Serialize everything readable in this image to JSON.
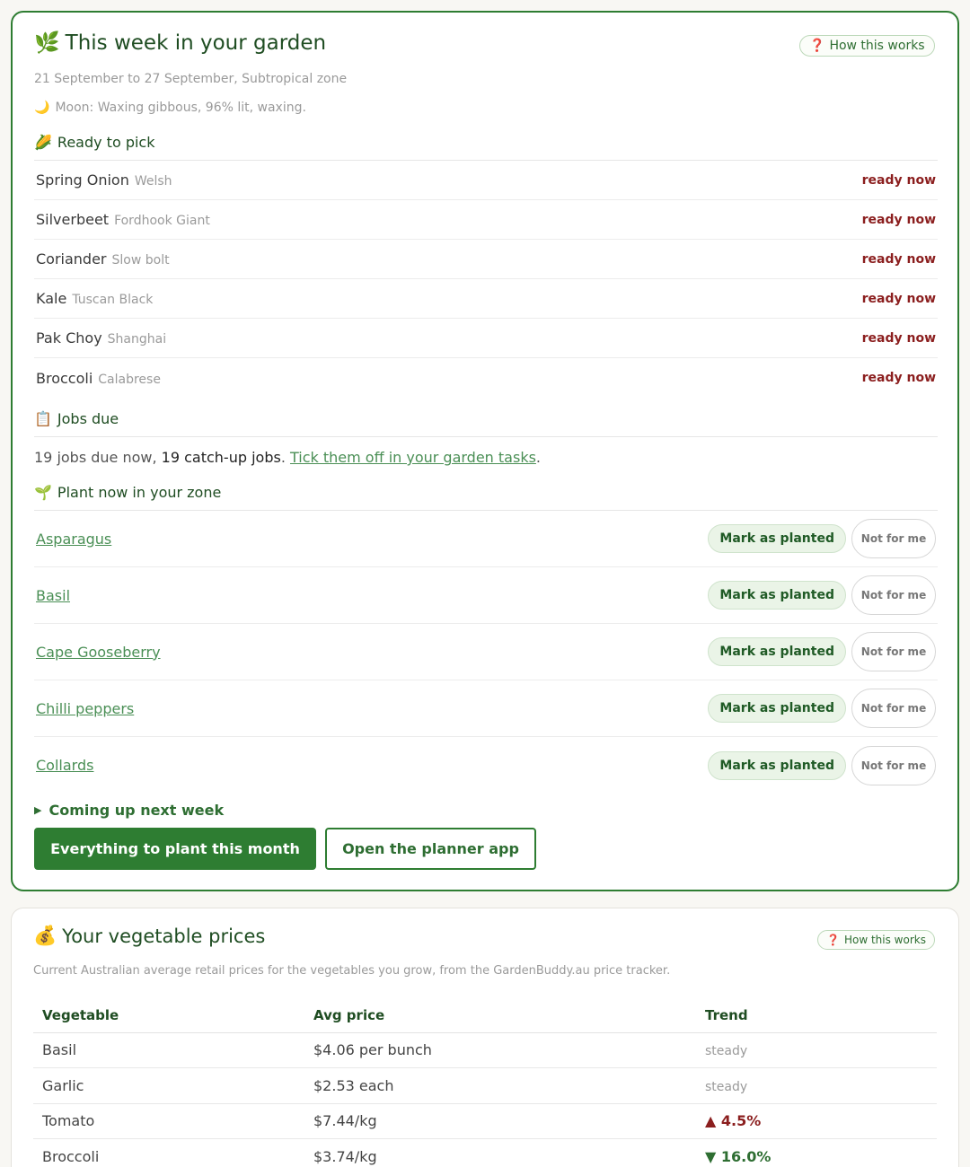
{
  "garden": {
    "emoji": "🌿",
    "title": "This week in your garden",
    "help_label": "How this works",
    "help_icon": "❓",
    "date_range": "21 September to 27 September, Subtropical zone",
    "moon_emoji": "🌙",
    "moon": "Moon: Waxing gibbous, 96% lit, waxing.",
    "ready": {
      "emoji": "🌽",
      "heading": "Ready to pick",
      "items": [
        {
          "name": "Spring Onion",
          "variety": "Welsh",
          "status": "ready now"
        },
        {
          "name": "Silverbeet",
          "variety": "Fordhook Giant",
          "status": "ready now"
        },
        {
          "name": "Coriander",
          "variety": "Slow bolt",
          "status": "ready now"
        },
        {
          "name": "Kale",
          "variety": "Tuscan Black",
          "status": "ready now"
        },
        {
          "name": "Pak Choy",
          "variety": "Shanghai",
          "status": "ready now"
        },
        {
          "name": "Broccoli",
          "variety": "Calabrese",
          "status": "ready now"
        }
      ]
    },
    "jobs": {
      "emoji": "📋",
      "heading": "Jobs due",
      "due_text": "19 jobs due now, ",
      "catchup_text": "19 catch-up jobs",
      "sep": ". ",
      "link_text": "Tick them off in your garden tasks",
      "end": "."
    },
    "plant_now": {
      "emoji": "🌱",
      "heading": "Plant now in your zone",
      "mark_label": "Mark as planted",
      "not_label": "Not for me",
      "items": [
        {
          "name": "Asparagus"
        },
        {
          "name": "Basil"
        },
        {
          "name": "Cape Gooseberry"
        },
        {
          "name": "Chilli peppers"
        },
        {
          "name": "Collards"
        }
      ]
    },
    "coming_up": "Coming up next week",
    "btn_month": "Everything to plant this month",
    "btn_planner": "Open the planner app"
  },
  "prices": {
    "emoji": "💰",
    "title": "Your vegetable prices",
    "help_label": "How this works",
    "help_icon": "❓",
    "subtitle": "Current Australian average retail prices for the vegetables you grow, from the GardenBuddy.au price tracker.",
    "columns": [
      "Vegetable",
      "Avg price",
      "Trend"
    ],
    "rows": [
      {
        "veg": "Basil",
        "price": "$4.06 per bunch",
        "trend": "steady",
        "dir": "steady"
      },
      {
        "veg": "Garlic",
        "price": "$2.53 each",
        "trend": "steady",
        "dir": "steady"
      },
      {
        "veg": "Tomato",
        "price": "$7.44/kg",
        "trend": "▲ 4.5%",
        "dir": "up"
      },
      {
        "veg": "Broccoli",
        "price": "$3.74/kg",
        "trend": "▼ 16.0%",
        "dir": "down"
      }
    ]
  },
  "colors": {
    "accent": "#2e7d32",
    "ready": "#8b1e1e",
    "link": "#4a8f55"
  }
}
